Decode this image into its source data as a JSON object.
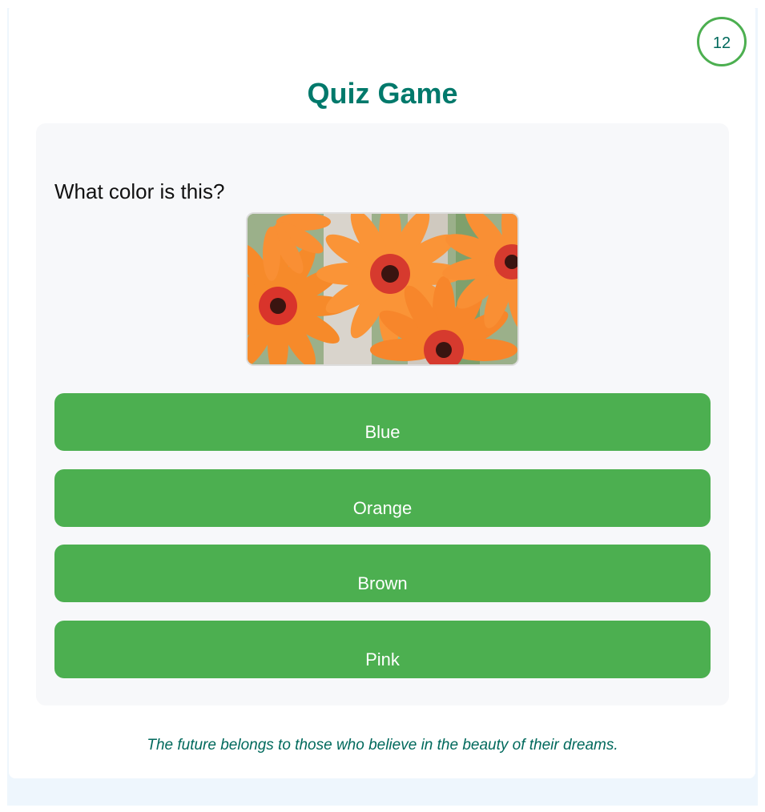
{
  "timer": {
    "value": "12"
  },
  "header": {
    "title": "Quiz Game"
  },
  "question": {
    "text": "What color is this?",
    "image_subject": "orange gerbera daisies"
  },
  "answers": [
    {
      "label": "Blue"
    },
    {
      "label": "Orange"
    },
    {
      "label": "Brown"
    },
    {
      "label": "Pink"
    }
  ],
  "footer": {
    "quote": "The future belongs to those who believe in the beauty of their dreams."
  },
  "colors": {
    "accent_green": "#4caf50",
    "title_teal": "#00796b",
    "quote_teal": "#00695c",
    "card_bg": "#f7f8fa"
  }
}
